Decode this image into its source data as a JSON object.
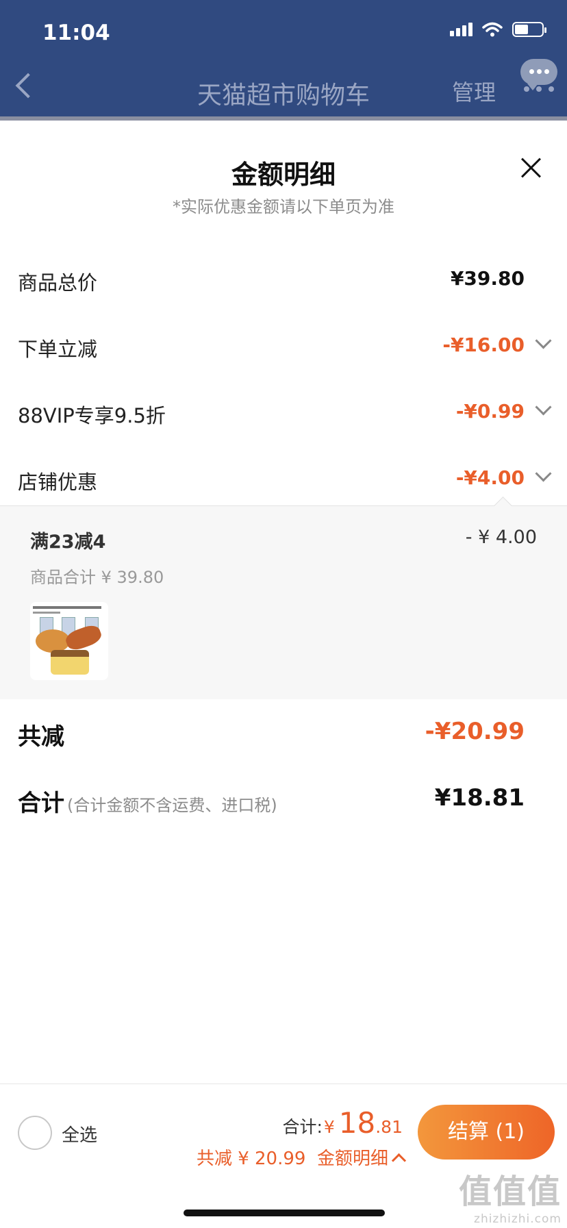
{
  "status": {
    "time": "11:04"
  },
  "nav": {
    "title": "天猫超市购物车",
    "manage": "管理"
  },
  "sheet": {
    "title": "金额明细",
    "subtitle": "*实际优惠金额请以下单页为准",
    "rows": [
      {
        "label": "商品总价",
        "value": "¥39.80"
      },
      {
        "label": "下单立减",
        "value": "-¥16.00"
      },
      {
        "label": "88VIP专享9.5折",
        "value": "-¥0.99"
      },
      {
        "label": "店铺优惠",
        "value": "-¥4.00"
      }
    ],
    "store_discount": {
      "title": "满23减4",
      "amount": "- ¥ 4.00",
      "subtotal": "商品合计 ¥ 39.80"
    },
    "total_discount": {
      "label": "共减",
      "value": "-¥20.99"
    },
    "total": {
      "label": "合计",
      "note": "(合计金额不含运费、进口税)",
      "value": "¥18.81"
    }
  },
  "bottom": {
    "select_all": "全选",
    "total_label": "合计:",
    "currency": "¥",
    "total_int": "18",
    "total_dec": ".81",
    "discount_text": "共减 ¥ 20.99",
    "detail_link": "金额明细",
    "checkout": "结算 (1)"
  },
  "watermark": {
    "text": "值值值",
    "site": "zhizhizhi.com"
  },
  "colors": {
    "header": "#304a80",
    "accent": "#e95e2a",
    "checkout_from": "#f3973c",
    "checkout_to": "#ee6528"
  }
}
